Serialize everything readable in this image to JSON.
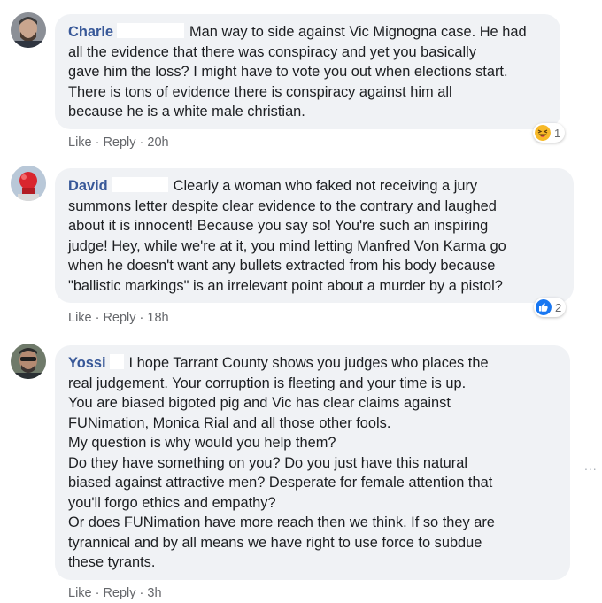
{
  "comments": [
    {
      "author": "Charle",
      "lines": [
        "Man way to side against Vic Mignogna case. He had",
        "all the evidence that there was conspiracy and yet you basically",
        "gave him the loss? I might have to vote you out when elections start.",
        "There is tons of evidence there is conspiracy against him all",
        "because he is a white male christian."
      ],
      "like": "Like",
      "reply": "Reply",
      "time": "20h",
      "reaction_icon": "haha-icon",
      "reaction_count": "1"
    },
    {
      "author": "David",
      "lines": [
        "Clearly a woman who faked not receiving a jury",
        "summons letter despite clear evidence to the contrary and laughed",
        "about it is innocent! Because you say so! You're such an inspiring",
        "judge! Hey, while we're at it, you mind letting Manfred Von Karma go",
        "when he doesn't want any bullets extracted from his body because",
        "\"ballistic markings\" is an irrelevant point about a murder by a pistol?"
      ],
      "like": "Like",
      "reply": "Reply",
      "time": "18h",
      "reaction_icon": "like-icon",
      "reaction_count": "2"
    },
    {
      "author": "Yossi",
      "lines": [
        "I hope Tarrant County shows you judges who places the",
        "real judgement. Your corruption is fleeting and your time is up.",
        "You are biased bigoted pig and Vic has clear claims against",
        "FUNimation, Monica Rial and all those other fools.",
        "My question is why would you help them?",
        "Do they have something on you? Do you just have this natural",
        "biased against attractive men? Desperate for female attention that",
        "you'll forgo ethics and empathy?",
        "Or does FUNimation have more reach then we think. If so they are",
        "tyrannical and by all means we have right to use force to subdue",
        "these tyrants."
      ],
      "like": "Like",
      "reply": "Reply",
      "time": "3h"
    }
  ],
  "more_options": "..."
}
